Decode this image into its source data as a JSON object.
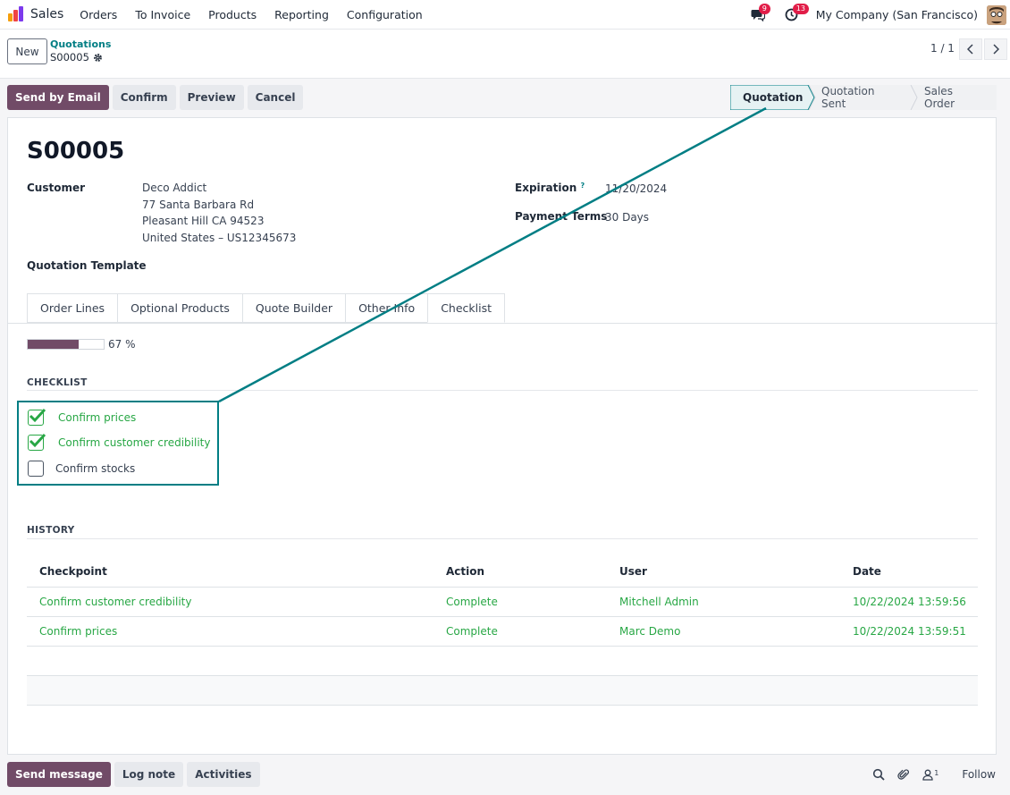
{
  "nav": {
    "app_name": "Sales",
    "items": [
      "Orders",
      "To Invoice",
      "Products",
      "Reporting",
      "Configuration"
    ],
    "messages_count": "9",
    "activities_count": "13",
    "company": "My Company (San Francisco)"
  },
  "control_panel": {
    "new_label": "New",
    "breadcrumb_parent": "Quotations",
    "breadcrumb_current": "S00005",
    "pager": "1 / 1"
  },
  "actions": {
    "send_email": "Send by Email",
    "confirm": "Confirm",
    "preview": "Preview",
    "cancel": "Cancel"
  },
  "status": {
    "stages": [
      "Quotation",
      "Quotation Sent",
      "Sales Order"
    ],
    "active": "Quotation"
  },
  "form": {
    "title": "S00005",
    "customer_label": "Customer",
    "customer_lines": [
      "Deco Addict",
      "77 Santa Barbara Rd",
      "Pleasant Hill CA 94523",
      "United States – US12345673"
    ],
    "expiration_label": "Expiration",
    "expiration_help": "?",
    "expiration_value": "11/20/2024",
    "payment_terms_label": "Payment Terms",
    "payment_terms_value": "30 Days",
    "template_label": "Quotation Template"
  },
  "tabs": [
    "Order Lines",
    "Optional Products",
    "Quote Builder",
    "Other Info",
    "Checklist"
  ],
  "active_tab": "Checklist",
  "checklist": {
    "progress_percent": 67,
    "progress_text": "67 %",
    "section_title": "CHECKLIST",
    "items": [
      {
        "label": "Confirm prices",
        "checked": true
      },
      {
        "label": "Confirm customer credibility",
        "checked": true
      },
      {
        "label": "Confirm stocks",
        "checked": false
      }
    ]
  },
  "history": {
    "section_title": "HISTORY",
    "columns": [
      "Checkpoint",
      "Action",
      "User",
      "Date"
    ],
    "rows": [
      [
        "Confirm customer credibility",
        "Complete",
        "Mitchell Admin",
        "10/22/2024 13:59:56"
      ],
      [
        "Confirm prices",
        "Complete",
        "Marc Demo",
        "10/22/2024 13:59:51"
      ]
    ]
  },
  "chatter": {
    "send_message": "Send message",
    "log_note": "Log note",
    "activities": "Activities",
    "followers_count": "1",
    "follow": "Follow"
  },
  "colors": {
    "primary": "#714b67",
    "accent": "#017e84",
    "success": "#28a745",
    "badge": "#e11d48"
  }
}
